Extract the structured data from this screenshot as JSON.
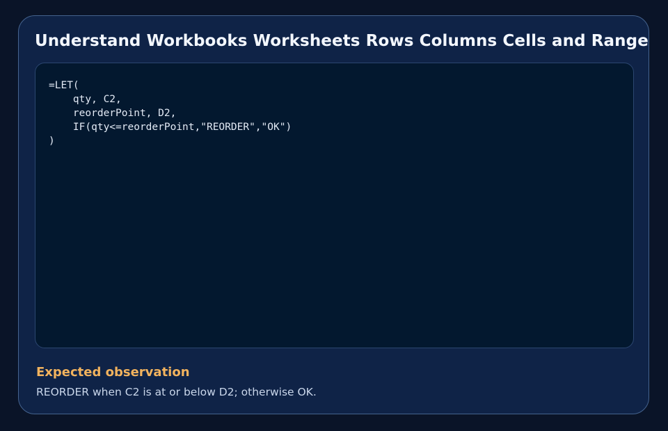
{
  "card": {
    "title": "Understand Workbooks Worksheets Rows Columns Cells and Ranges",
    "code": "=LET(\n    qty, C2,\n    reorderPoint, D2,\n    IF(qty<=reorderPoint,\"REORDER\",\"OK\")\n)",
    "observation": {
      "heading": "Expected observation",
      "text": "REORDER when C2 is at or below D2; otherwise OK."
    }
  },
  "colors": {
    "background": "#0a1428",
    "card": "#0f2347",
    "card_border": "#45638e",
    "code_panel": "#03182f",
    "accent": "#f2b35e"
  }
}
